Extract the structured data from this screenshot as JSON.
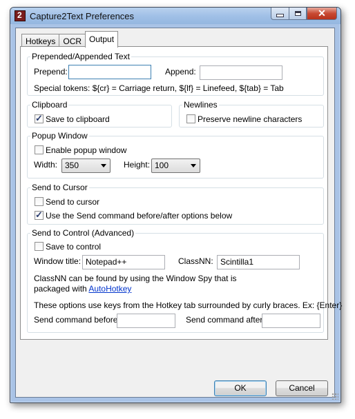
{
  "window": {
    "title": "Capture2Text Preferences"
  },
  "tabs": [
    {
      "label": "Hotkeys",
      "active": false
    },
    {
      "label": "OCR",
      "active": false
    },
    {
      "label": "Output",
      "active": true
    }
  ],
  "prepend_append": {
    "title": "Prepended/Appended Text",
    "prepend_label": "Prepend:",
    "prepend_value": "",
    "append_label": "Append:",
    "append_value": "",
    "tokens_text": "Special tokens:  ${cr} = Carriage return,  ${lf} = Linefeed,  ${tab} = Tab"
  },
  "clipboard": {
    "title": "Clipboard",
    "save_label": "Save to clipboard",
    "save_checked": true
  },
  "newlines": {
    "title": "Newlines",
    "preserve_label": "Preserve newline characters",
    "preserve_checked": false
  },
  "popup": {
    "title": "Popup Window",
    "enable_label": "Enable popup window",
    "enable_checked": false,
    "width_label": "Width:",
    "width_value": "350",
    "height_label": "Height:",
    "height_value": "100"
  },
  "send_cursor": {
    "title": "Send to Cursor",
    "send_label": "Send to cursor",
    "send_checked": false,
    "use_send_label": "Use the Send command before/after options below",
    "use_send_checked": true
  },
  "send_control": {
    "title": "Send to Control (Advanced)",
    "save_label": "Save to control",
    "save_checked": false,
    "window_title_label": "Window title:",
    "window_title_value": "Notepad++",
    "classnn_label": "ClassNN:",
    "classnn_value": "Scintilla1",
    "info_line1": "ClassNN can be found by using the Window Spy that is",
    "info_line2_prefix": "packaged with",
    "autohotkey_link": "AutoHotkey",
    "options_note": "These options use keys from the Hotkey tab surrounded by curly braces. Ex: {Enter}",
    "before_label": "Send command before:",
    "before_value": "",
    "after_label": "Send command after:",
    "after_value": ""
  },
  "buttons": {
    "ok": "OK",
    "cancel": "Cancel"
  }
}
